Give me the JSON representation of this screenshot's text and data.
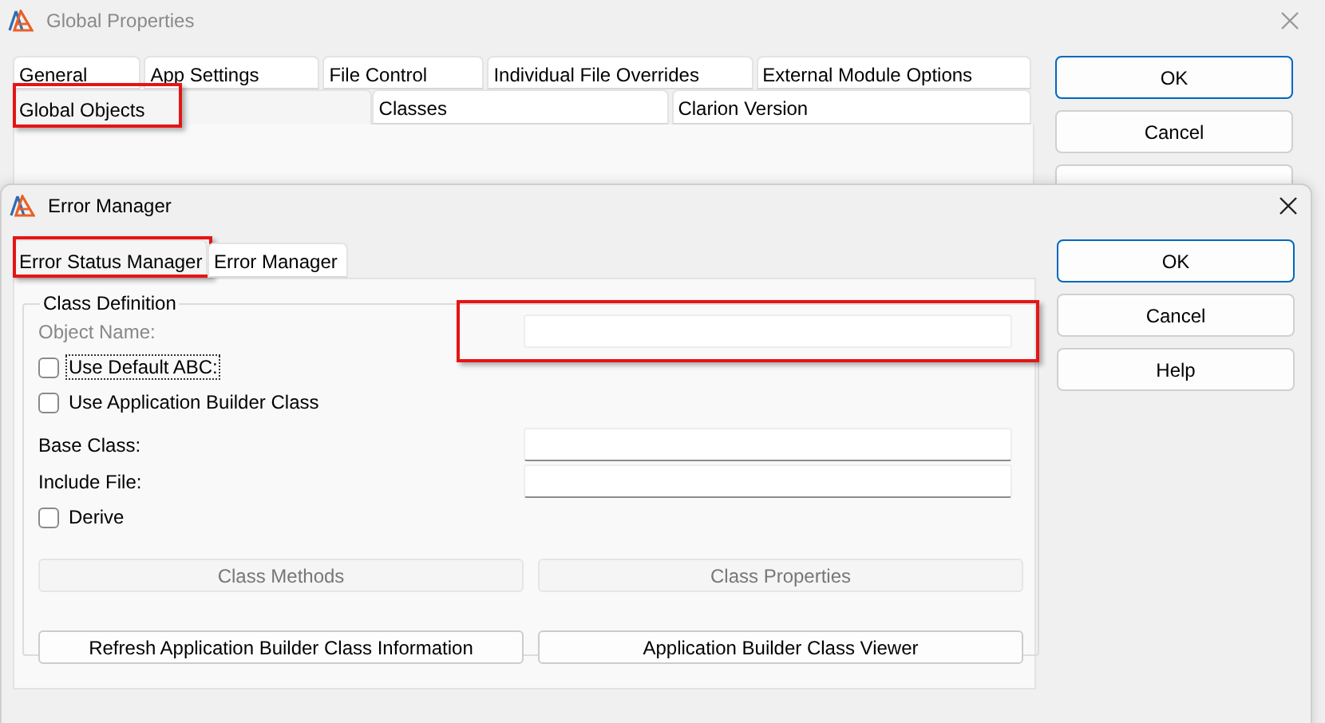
{
  "back_window": {
    "title": "Global Properties",
    "tab_rows": [
      [
        {
          "label": "General",
          "selected": false
        },
        {
          "label": "App Settings",
          "selected": false
        },
        {
          "label": "File Control",
          "selected": false
        },
        {
          "label": "Individual File Overrides",
          "selected": false
        },
        {
          "label": "External Module Options",
          "selected": false
        }
      ],
      [
        {
          "label": "Global Objects",
          "selected": true,
          "highlighted": true
        },
        {
          "label": "Classes",
          "selected": false,
          "highlighted": false
        },
        {
          "label": "Clarion Version",
          "selected": false,
          "highlighted": false
        }
      ]
    ],
    "buttons": [
      {
        "kind": "button",
        "label": "OK",
        "default": true
      },
      {
        "kind": "button",
        "label": "Cancel",
        "default": false
      },
      {
        "kind": "covered"
      }
    ]
  },
  "front_window": {
    "title": "Error Manager",
    "tabs": [
      {
        "label": "Error Status Manager",
        "selected": true,
        "highlighted": true
      },
      {
        "label": "Error Manager",
        "selected": false,
        "highlighted": false
      }
    ],
    "group": {
      "title": "Class Definition",
      "rows": [
        {
          "kind": "field",
          "label": "Object Name:",
          "disabled": true,
          "highlighted": true
        },
        {
          "kind": "checkbox",
          "label": "Use Default ABC:",
          "checked": false,
          "focused": true
        },
        {
          "kind": "checkbox",
          "label": "Use Application Builder Class",
          "checked": false,
          "focused": false
        },
        {
          "kind": "field",
          "label": "Base Class:",
          "disabled": false,
          "highlighted": false
        },
        {
          "kind": "field",
          "label": "Include File:",
          "disabled": false,
          "highlighted": false
        },
        {
          "kind": "checkbox",
          "label": "Derive",
          "checked": false,
          "focused": false
        }
      ],
      "buttons": [
        {
          "label": "Class Methods",
          "disabled": true
        },
        {
          "label": "Class Properties",
          "disabled": true
        },
        {
          "label": "Refresh Application Builder Class Information",
          "disabled": false
        },
        {
          "label": "Application Builder Class Viewer",
          "disabled": false
        }
      ]
    },
    "buttons": [
      {
        "kind": "button",
        "label": "OK",
        "default": true
      },
      {
        "kind": "button",
        "label": "Cancel",
        "default": false
      },
      {
        "kind": "button",
        "label": "Help",
        "default": false
      }
    ]
  }
}
